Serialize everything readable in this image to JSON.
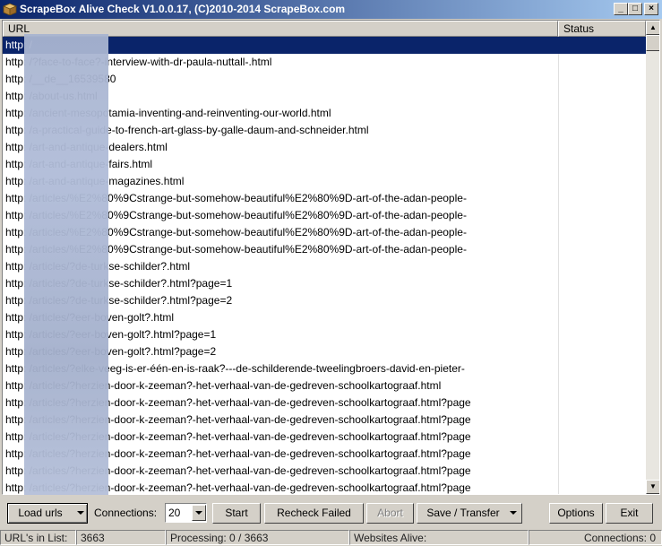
{
  "window": {
    "title": "ScrapeBox Alive Check V1.0.0.17, (C)2010-2014 ScrapeBox.com",
    "minimize_glyph": "_",
    "maximize_glyph": "□",
    "close_glyph": "×"
  },
  "list": {
    "columns": {
      "url": "URL",
      "status": "Status"
    },
    "rows": [
      {
        "url": "http:                              /",
        "status": ""
      },
      {
        "url": "http:                              /?face-to-face?-interview-with-dr-paula-nuttall-.html",
        "status": ""
      },
      {
        "url": "http:                              /__de__16539580",
        "status": ""
      },
      {
        "url": "http:                              /about-us.html",
        "status": ""
      },
      {
        "url": "http:                              /ancient-mesopotamia-inventing-and-reinventing-our-world.html",
        "status": ""
      },
      {
        "url": "http:                              /a-practical-guide-to-french-art-glass-by-galle-daum-and-schneider.html",
        "status": ""
      },
      {
        "url": "http:                              /art-and-antique-dealers.html",
        "status": ""
      },
      {
        "url": "http:                              /art-and-antique-fairs.html",
        "status": ""
      },
      {
        "url": "http:                              /art-and-antique-magazines.html",
        "status": ""
      },
      {
        "url": "http:                              /articles/%E2%80%9Cstrange-but-somehow-beautiful%E2%80%9D-art-of-the-adan-people-",
        "status": ""
      },
      {
        "url": "http:                              /articles/%E2%80%9Cstrange-but-somehow-beautiful%E2%80%9D-art-of-the-adan-people-",
        "status": ""
      },
      {
        "url": "http:                              /articles/%E2%80%9Cstrange-but-somehow-beautiful%E2%80%9D-art-of-the-adan-people-",
        "status": ""
      },
      {
        "url": "http:                              /articles/%E2%80%9Cstrange-but-somehow-beautiful%E2%80%9D-art-of-the-adan-people-",
        "status": ""
      },
      {
        "url": "http:                              /articles/?de-turkse-schilder?.html",
        "status": ""
      },
      {
        "url": "http:                              /articles/?de-turkse-schilder?.html?page=1",
        "status": ""
      },
      {
        "url": "http:                              /articles/?de-turkse-schilder?.html?page=2",
        "status": ""
      },
      {
        "url": "http:                              /articles/?eer-boven-golt?.html",
        "status": ""
      },
      {
        "url": "http:                              /articles/?eer-boven-golt?.html?page=1",
        "status": ""
      },
      {
        "url": "http:                              /articles/?eer-boven-golt?.html?page=2",
        "status": ""
      },
      {
        "url": "http:                              /articles/?elke-veeg-is-er-één-en-is-raak?---de-schilderende-tweelingbroers-david-en-pieter-",
        "status": ""
      },
      {
        "url": "http:                              /articles/?herzien-door-k-zeeman?-het-verhaal-van-de-gedreven-schoolkartograaf.html",
        "status": ""
      },
      {
        "url": "http:                              /articles/?herzien-door-k-zeeman?-het-verhaal-van-de-gedreven-schoolkartograaf.html?page",
        "status": ""
      },
      {
        "url": "http:                              /articles/?herzien-door-k-zeeman?-het-verhaal-van-de-gedreven-schoolkartograaf.html?page",
        "status": ""
      },
      {
        "url": "http:                              /articles/?herzien-door-k-zeeman?-het-verhaal-van-de-gedreven-schoolkartograaf.html?page",
        "status": ""
      },
      {
        "url": "http:                              /articles/?herzien-door-k-zeeman?-het-verhaal-van-de-gedreven-schoolkartograaf.html?page",
        "status": ""
      },
      {
        "url": "http:                              /articles/?herzien-door-k-zeeman?-het-verhaal-van-de-gedreven-schoolkartograaf.html?page",
        "status": ""
      },
      {
        "url": "http:                              /articles/?herzien-door-k-zeeman?-het-verhaal-van-de-gedreven-schoolkartograaf.html?page",
        "status": ""
      },
      {
        "url": "http:                              /articles/?herzien-door-k-zeeman?-het-verhaal-van-de-gedreven-schoolkartograaf.html?page",
        "status": ""
      }
    ],
    "selected_index": 0
  },
  "toolbar": {
    "load_urls": "Load urls",
    "connections_label": "Connections:",
    "connections_value": "20",
    "start": "Start",
    "recheck_failed": "Recheck Failed",
    "abort": "Abort",
    "save_transfer": "Save / Transfer",
    "options": "Options",
    "exit": "Exit"
  },
  "statusbar": {
    "urls_label": "URL's in List:",
    "urls_value": "3663",
    "processing_label": "Processing:",
    "processing_value": "0 / 3663",
    "alive_label": "Websites Alive:",
    "alive_value": "",
    "connections": "Connections: 0"
  }
}
